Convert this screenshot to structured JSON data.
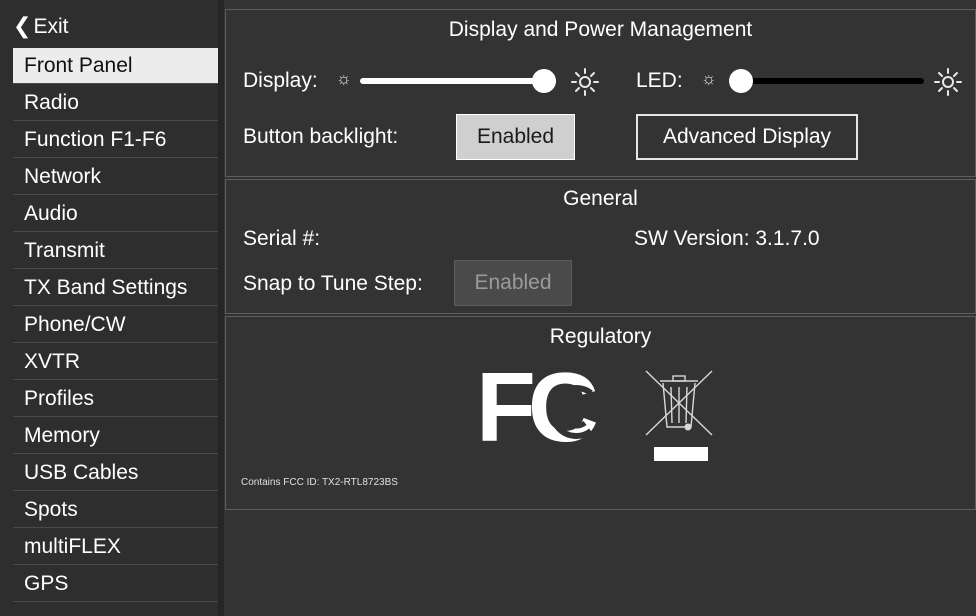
{
  "sidebar": {
    "exit_label": "Exit",
    "items": [
      {
        "label": "Front Panel"
      },
      {
        "label": "Radio"
      },
      {
        "label": "Function F1-F6"
      },
      {
        "label": "Network"
      },
      {
        "label": "Audio"
      },
      {
        "label": "Transmit"
      },
      {
        "label": "TX Band Settings"
      },
      {
        "label": "Phone/CW"
      },
      {
        "label": "XVTR"
      },
      {
        "label": "Profiles"
      },
      {
        "label": "Memory"
      },
      {
        "label": "USB Cables"
      },
      {
        "label": "Spots"
      },
      {
        "label": "multiFLEX"
      },
      {
        "label": "GPS"
      }
    ],
    "selected": "Front Panel"
  },
  "display_power": {
    "title": "Display and Power Management",
    "display_label": "Display:",
    "display_level": 1.0,
    "led_label": "LED:",
    "led_level": 0.0,
    "backlight_label": "Button backlight:",
    "backlight_button": "Enabled",
    "advanced_button": "Advanced Display"
  },
  "general": {
    "title": "General",
    "serial_label": "Serial #:",
    "sw_version_label": "SW Version: 3.1.7.0",
    "snap_label": "Snap to Tune Step:",
    "snap_button": "Enabled"
  },
  "regulatory": {
    "title": "Regulatory",
    "fcc_logo_text": "FC",
    "fcc_id": "Contains FCC ID: TX2-RTL8723BS"
  },
  "icons": {
    "exit": "chevron-left-icon",
    "brightness_low": "sun-small-icon",
    "brightness_high": "sun-large-icon",
    "fcc": "fcc-logo",
    "weee": "crossed-bin-icon"
  },
  "colors": {
    "background": "#333333",
    "sidebar": "#2e2e2e",
    "selected": "#ececec",
    "track": "#000000",
    "thumb": "#ffffff"
  }
}
